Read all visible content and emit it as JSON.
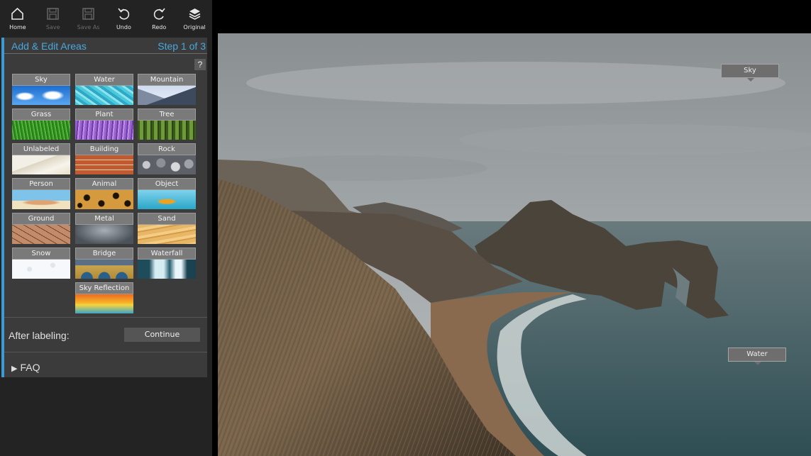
{
  "toolbar": {
    "home": "Home",
    "save": "Save",
    "save_as": "Save As",
    "undo": "Undo",
    "redo": "Redo",
    "original": "Original"
  },
  "panel": {
    "title": "Add & Edit Areas",
    "step": "Step 1 of 3",
    "help": "?",
    "accent_color": "#3d9bd2"
  },
  "categories": {
    "sky": "Sky",
    "water": "Water",
    "mountain": "Mountain",
    "grass": "Grass",
    "plant": "Plant",
    "tree": "Tree",
    "unlabeled": "Unlabeled",
    "building": "Building",
    "rock": "Rock",
    "person": "Person",
    "animal": "Animal",
    "object": "Object",
    "ground": "Ground",
    "metal": "Metal",
    "sand": "Sand",
    "snow": "Snow",
    "bridge": "Bridge",
    "waterfall": "Waterfall",
    "sky_reflection": "Sky Reflection"
  },
  "after": {
    "label": "After labeling:",
    "continue": "Continue"
  },
  "faq": {
    "label": "FAQ",
    "arrow": "▶"
  },
  "canvas_labels": {
    "sky": "Sky",
    "water": "Water"
  }
}
